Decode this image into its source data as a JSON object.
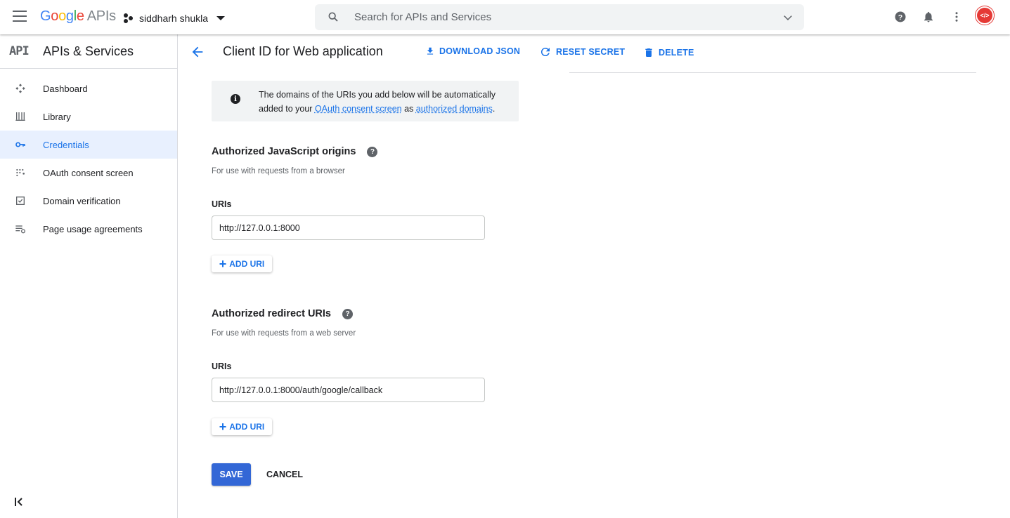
{
  "topbar": {
    "logo": {
      "g1": "G",
      "o1": "o",
      "o2": "o",
      "g2": "g",
      "l": "l",
      "e": "e",
      "apis": "APIs"
    },
    "project_name": "siddharh shukla",
    "search_placeholder": "Search for APIs and Services"
  },
  "sidebar": {
    "glyph": "API",
    "title": "APIs & Services",
    "items": [
      {
        "label": "Dashboard",
        "icon": "dashboard-icon"
      },
      {
        "label": "Library",
        "icon": "library-icon"
      },
      {
        "label": "Credentials",
        "icon": "key-icon",
        "active": true
      },
      {
        "label": "OAuth consent screen",
        "icon": "consent-icon"
      },
      {
        "label": "Domain verification",
        "icon": "checkbox-icon"
      },
      {
        "label": "Page usage agreements",
        "icon": "settings-list-icon"
      }
    ]
  },
  "header": {
    "title": "Client ID for Web application",
    "download_json": "DOWNLOAD JSON",
    "reset_secret": "RESET SECRET",
    "delete": "DELETE"
  },
  "info": {
    "text_before": "The domains of the URIs you add below will be automatically added to your ",
    "link1": "OAuth consent screen",
    "text_middle": " as ",
    "link2": "authorized domains",
    "text_after": "."
  },
  "js_origins": {
    "title": "Authorized JavaScript origins",
    "subtitle": "For use with requests from a browser",
    "uris_label": "URIs",
    "uri_value": "http://127.0.0.1:8000",
    "add_uri": "ADD URI"
  },
  "redirect_uris": {
    "title": "Authorized redirect URIs",
    "subtitle": "For use with requests from a web server",
    "uris_label": "URIs",
    "uri_value": "http://127.0.0.1:8000/auth/google/callback",
    "add_uri": "ADD URI"
  },
  "actions": {
    "save": "SAVE",
    "cancel": "CANCEL"
  },
  "colors": {
    "accent": "#1a73e8",
    "save_button": "#3367d6",
    "active_nav_bg": "#e8f0fe",
    "avatar": "#e53935"
  }
}
